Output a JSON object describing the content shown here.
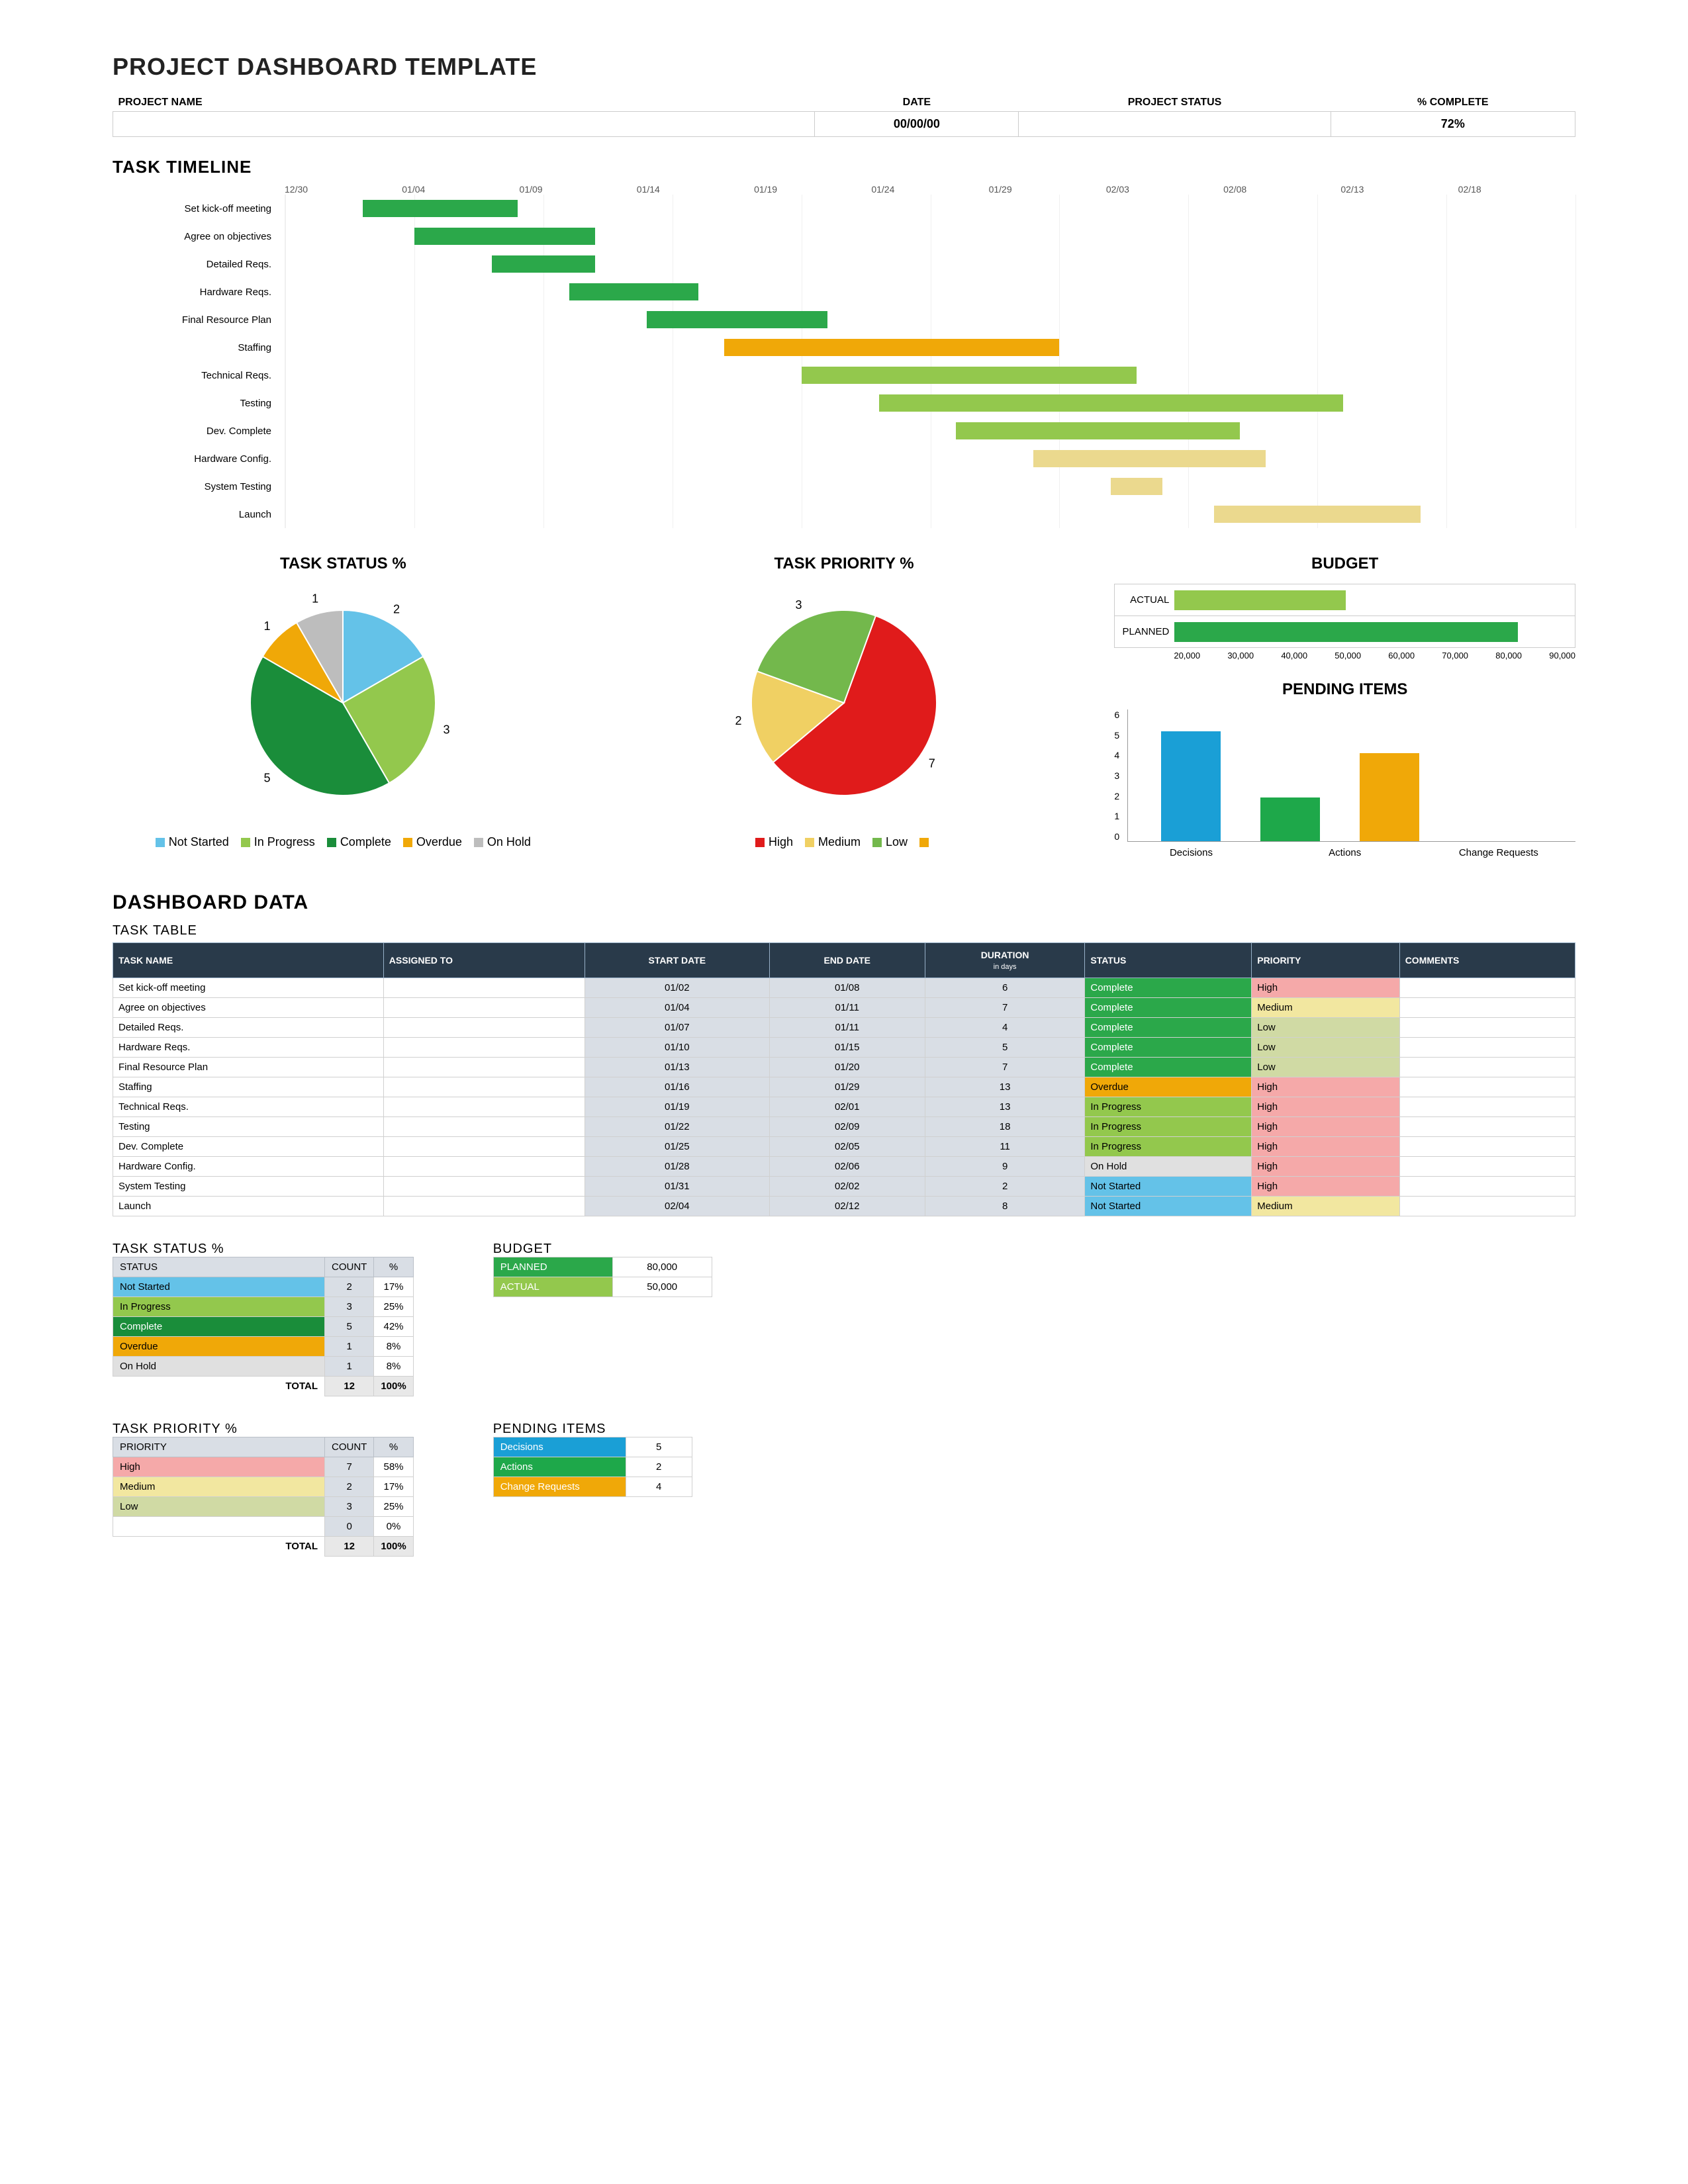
{
  "title": "PROJECT DASHBOARD TEMPLATE",
  "header": {
    "labels": {
      "projectName": "PROJECT NAME",
      "date": "DATE",
      "projectStatus": "PROJECT STATUS",
      "pctComplete": "% COMPLETE"
    },
    "values": {
      "projectName": "",
      "date": "00/00/00",
      "projectStatus": "",
      "pctComplete": "72%"
    }
  },
  "timeline": {
    "heading": "TASK TIMELINE",
    "dates": [
      "12/30",
      "01/04",
      "01/09",
      "01/14",
      "01/19",
      "01/24",
      "01/29",
      "02/03",
      "02/08",
      "02/13",
      "02/18"
    ],
    "colors": {
      "Complete": "#2ba84a",
      "In Progress": "#93c84d",
      "Overdue": "#f0a808",
      "On Hold": "#ebd98e",
      "Not Started": "#ebd98e"
    }
  },
  "taskStatus": {
    "heading": "TASK STATUS %",
    "legend": [
      {
        "label": "Not Started",
        "color": "#64c2e8"
      },
      {
        "label": "In Progress",
        "color": "#93c84d"
      },
      {
        "label": "Complete",
        "color": "#1a8d3a"
      },
      {
        "label": "Overdue",
        "color": "#f0a808"
      },
      {
        "label": "On Hold",
        "color": "#bdbdbd"
      }
    ]
  },
  "taskPriority": {
    "heading": "TASK PRIORITY %",
    "legend": [
      {
        "label": "High",
        "color": "#e01b1b"
      },
      {
        "label": "Medium",
        "color": "#f0d063"
      },
      {
        "label": "Low",
        "color": "#73b84c"
      },
      {
        "label": "",
        "color": "#f0a808"
      }
    ]
  },
  "budgetChart": {
    "heading": "BUDGET",
    "rows": [
      {
        "label": "ACTUAL",
        "value": 50000,
        "color": "#93c84d"
      },
      {
        "label": "PLANNED",
        "value": 80000,
        "color": "#2ba84a"
      }
    ],
    "min": 20000,
    "max": 90000,
    "ticks": [
      "20,000",
      "30,000",
      "40,000",
      "50,000",
      "60,000",
      "70,000",
      "80,000",
      "90,000"
    ]
  },
  "pendingChart": {
    "heading": "PENDING ITEMS",
    "ymax": 6,
    "ticks": [
      "0",
      "1",
      "2",
      "3",
      "4",
      "5",
      "6"
    ],
    "bars": [
      {
        "label": "Decisions",
        "value": 5,
        "color": "#1a9fd6"
      },
      {
        "label": "Actions",
        "value": 2,
        "color": "#1ea84a"
      },
      {
        "label": "Change Requests",
        "value": 4,
        "color": "#f0a808"
      }
    ]
  },
  "dashboardData": {
    "heading": "DASHBOARD DATA",
    "taskTable": {
      "heading": "TASK TABLE",
      "columns": [
        "TASK NAME",
        "ASSIGNED TO",
        "START DATE",
        "END DATE",
        "DURATION in days",
        "STATUS",
        "PRIORITY",
        "COMMENTS"
      ],
      "rows": [
        {
          "name": "Set kick-off meeting",
          "assigned": "",
          "start": "01/02",
          "end": "01/08",
          "duration": "6",
          "status": "Complete",
          "priority": "High",
          "comments": ""
        },
        {
          "name": "Agree on objectives",
          "assigned": "",
          "start": "01/04",
          "end": "01/11",
          "duration": "7",
          "status": "Complete",
          "priority": "Medium",
          "comments": ""
        },
        {
          "name": "Detailed Reqs.",
          "assigned": "",
          "start": "01/07",
          "end": "01/11",
          "duration": "4",
          "status": "Complete",
          "priority": "Low",
          "comments": ""
        },
        {
          "name": "Hardware Reqs.",
          "assigned": "",
          "start": "01/10",
          "end": "01/15",
          "duration": "5",
          "status": "Complete",
          "priority": "Low",
          "comments": ""
        },
        {
          "name": "Final Resource Plan",
          "assigned": "",
          "start": "01/13",
          "end": "01/20",
          "duration": "7",
          "status": "Complete",
          "priority": "Low",
          "comments": ""
        },
        {
          "name": "Staffing",
          "assigned": "",
          "start": "01/16",
          "end": "01/29",
          "duration": "13",
          "status": "Overdue",
          "priority": "High",
          "comments": ""
        },
        {
          "name": "Technical Reqs.",
          "assigned": "",
          "start": "01/19",
          "end": "02/01",
          "duration": "13",
          "status": "In Progress",
          "priority": "High",
          "comments": ""
        },
        {
          "name": "Testing",
          "assigned": "",
          "start": "01/22",
          "end": "02/09",
          "duration": "18",
          "status": "In Progress",
          "priority": "High",
          "comments": ""
        },
        {
          "name": "Dev. Complete",
          "assigned": "",
          "start": "01/25",
          "end": "02/05",
          "duration": "11",
          "status": "In Progress",
          "priority": "High",
          "comments": ""
        },
        {
          "name": "Hardware Config.",
          "assigned": "",
          "start": "01/28",
          "end": "02/06",
          "duration": "9",
          "status": "On Hold",
          "priority": "High",
          "comments": ""
        },
        {
          "name": "System Testing",
          "assigned": "",
          "start": "01/31",
          "end": "02/02",
          "duration": "2",
          "status": "Not Started",
          "priority": "High",
          "comments": ""
        },
        {
          "name": "Launch",
          "assigned": "",
          "start": "02/04",
          "end": "02/12",
          "duration": "8",
          "status": "Not Started",
          "priority": "Medium",
          "comments": ""
        }
      ]
    },
    "statusTable": {
      "heading": "TASK STATUS %",
      "columns": [
        "STATUS",
        "COUNT",
        "%"
      ],
      "rows": [
        {
          "label": "Not Started",
          "count": "2",
          "pct": "17%",
          "color": "#64c2e8"
        },
        {
          "label": "In Progress",
          "count": "3",
          "pct": "25%",
          "color": "#93c84d"
        },
        {
          "label": "Complete",
          "count": "5",
          "pct": "42%",
          "color": "#1a8d3a",
          "textcolor": "#fff"
        },
        {
          "label": "Overdue",
          "count": "1",
          "pct": "8%",
          "color": "#f0a808"
        },
        {
          "label": "On Hold",
          "count": "1",
          "pct": "8%",
          "color": "#e0e0e0"
        }
      ],
      "total": {
        "label": "TOTAL",
        "count": "12",
        "pct": "100%"
      }
    },
    "budgetTable": {
      "heading": "BUDGET",
      "rows": [
        {
          "label": "PLANNED",
          "value": "80,000",
          "color": "#2ba84a"
        },
        {
          "label": "ACTUAL",
          "value": "50,000",
          "color": "#93c84d"
        }
      ]
    },
    "priorityTable": {
      "heading": "TASK PRIORITY %",
      "columns": [
        "PRIORITY",
        "COUNT",
        "%"
      ],
      "rows": [
        {
          "label": "High",
          "count": "7",
          "pct": "58%",
          "color": "#f5a9a9"
        },
        {
          "label": "Medium",
          "count": "2",
          "pct": "17%",
          "color": "#f2e7a0"
        },
        {
          "label": "Low",
          "count": "3",
          "pct": "25%",
          "color": "#d0daa4"
        },
        {
          "label": "",
          "count": "0",
          "pct": "0%",
          "color": "#ffffff"
        }
      ],
      "total": {
        "label": "TOTAL",
        "count": "12",
        "pct": "100%"
      }
    },
    "pendingTable": {
      "heading": "PENDING ITEMS",
      "rows": [
        {
          "label": "Decisions",
          "value": "5",
          "color": "#1a9fd6"
        },
        {
          "label": "Actions",
          "value": "2",
          "color": "#1ea84a"
        },
        {
          "label": "Change Requests",
          "value": "4",
          "color": "#f0a808"
        }
      ]
    }
  },
  "colors": {
    "statusCell": {
      "Complete": "#2ba84a",
      "In Progress": "#93c84d",
      "Overdue": "#f0a808",
      "On Hold": "#e0e0e0",
      "Not Started": "#64c2e8"
    },
    "priorityCell": {
      "High": "#f5a9a9",
      "Medium": "#f2e7a0",
      "Low": "#d0daa4"
    }
  },
  "chart_data": [
    {
      "type": "gantt",
      "title": "TASK TIMELINE",
      "x_range": [
        "12/30",
        "02/18"
      ],
      "tasks_reference": "dashboardData.taskTable.rows"
    },
    {
      "type": "pie",
      "title": "TASK STATUS %",
      "categories": [
        "Not Started",
        "In Progress",
        "Complete",
        "Overdue",
        "On Hold"
      ],
      "values": [
        2,
        3,
        5,
        1,
        1
      ],
      "colors": [
        "#64c2e8",
        "#93c84d",
        "#1a8d3a",
        "#f0a808",
        "#bdbdbd"
      ]
    },
    {
      "type": "pie",
      "title": "TASK PRIORITY %",
      "categories": [
        "High",
        "Medium",
        "Low",
        ""
      ],
      "values": [
        7,
        2,
        3,
        0
      ],
      "colors": [
        "#e01b1b",
        "#f0d063",
        "#73b84c",
        "#f0a808"
      ]
    },
    {
      "type": "bar",
      "orientation": "horizontal",
      "title": "BUDGET",
      "categories": [
        "ACTUAL",
        "PLANNED"
      ],
      "values": [
        50000,
        80000
      ],
      "xlim": [
        20000,
        90000
      ]
    },
    {
      "type": "bar",
      "title": "PENDING ITEMS",
      "categories": [
        "Decisions",
        "Actions",
        "Change Requests"
      ],
      "values": [
        5,
        2,
        4
      ],
      "ylim": [
        0,
        6
      ]
    }
  ]
}
